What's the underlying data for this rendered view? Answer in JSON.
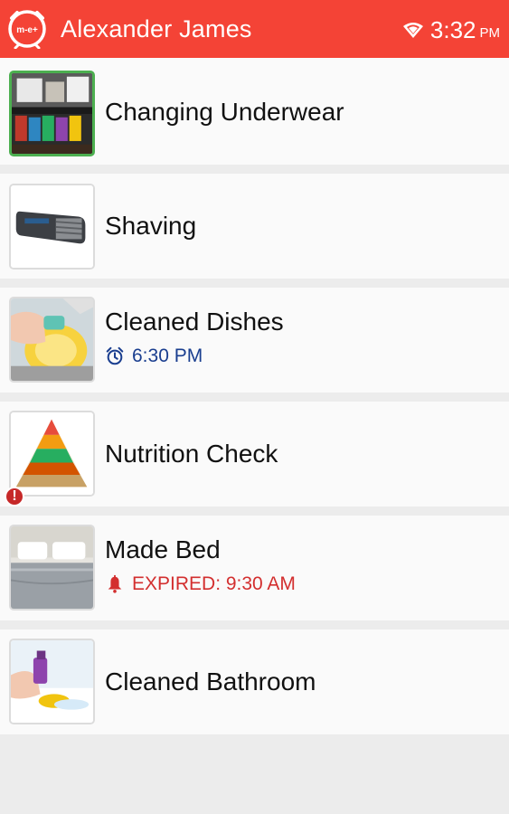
{
  "header": {
    "logo_text": "m-e+",
    "user_name": "Alexander James",
    "time": "3:32",
    "ampm": "PM",
    "bar_color": "#f44336"
  },
  "tasks": [
    {
      "title": "Changing Underwear",
      "image": "underwear-drawer-image",
      "selected": true
    },
    {
      "title": "Shaving",
      "image": "electric-shaver-image"
    },
    {
      "title": "Cleaned Dishes",
      "image": "dish-washing-image",
      "subtitle": "6:30 PM",
      "subtitle_icon": "alarm-clock-icon",
      "subtitle_color": "#1a3e8f"
    },
    {
      "title": "Nutrition Check",
      "image": "food-pyramid-image",
      "alert": "!"
    },
    {
      "title": "Made Bed",
      "image": "made-bed-image",
      "subtitle": "EXPIRED: 9:30 AM",
      "subtitle_icon": "bell-alert-icon",
      "subtitle_color": "#d32f2f"
    },
    {
      "title": "Cleaned Bathroom",
      "image": "bathroom-cleaning-image"
    }
  ]
}
